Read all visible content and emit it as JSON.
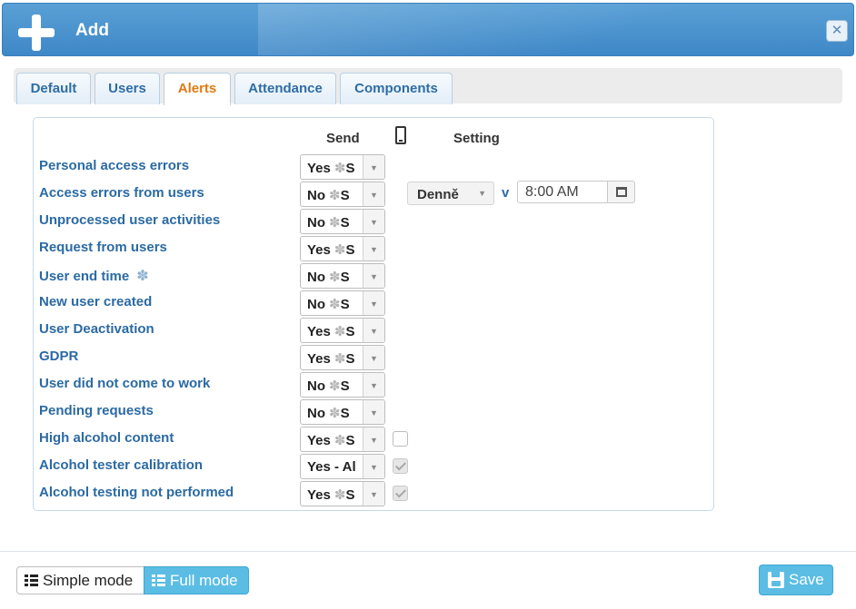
{
  "window": {
    "title": "Add"
  },
  "tabs": [
    {
      "label": "Default"
    },
    {
      "label": "Users"
    },
    {
      "label": "Alerts",
      "active": true
    },
    {
      "label": "Attendance"
    },
    {
      "label": "Components"
    }
  ],
  "headers": {
    "send": "Send",
    "setting": "Setting"
  },
  "rows": [
    {
      "label": "Personal access errors",
      "send": "Yes",
      "suffix": "S"
    },
    {
      "label": "Access errors from users",
      "send": "No",
      "suffix": "S"
    },
    {
      "label": "Unprocessed user activities",
      "send": "No",
      "suffix": "S"
    },
    {
      "label": "Request from users",
      "send": "Yes",
      "suffix": "S"
    },
    {
      "label": "User end time",
      "send": "No",
      "suffix": "S"
    },
    {
      "label": "New user created",
      "send": "No",
      "suffix": "S"
    },
    {
      "label": "User Deactivation",
      "send": "Yes",
      "suffix": "S"
    },
    {
      "label": "GDPR",
      "send": "Yes",
      "suffix": "S"
    },
    {
      "label": "User did not come to work",
      "send": "No",
      "suffix": "S"
    },
    {
      "label": "Pending requests",
      "send": "No",
      "suffix": "S"
    },
    {
      "label": "High alcohol content",
      "send": "Yes",
      "suffix": "S"
    },
    {
      "label": "Alcohol tester calibration",
      "send": "Yes - Al",
      "suffix": ""
    },
    {
      "label": "Alcohol testing not performed",
      "send": "Yes",
      "suffix": "S"
    }
  ],
  "star_glyph": "✽",
  "setting": {
    "period": "Denně",
    "v_label": "v",
    "time": "8:00 AM"
  },
  "footer": {
    "simple_mode": "Simple mode",
    "full_mode": "Full mode",
    "save": "Save"
  },
  "colors": {
    "accent": "#5bbde4",
    "label": "#2b6aa3",
    "active_tab": "#e07a12",
    "titlebar": "#4a94cf"
  }
}
